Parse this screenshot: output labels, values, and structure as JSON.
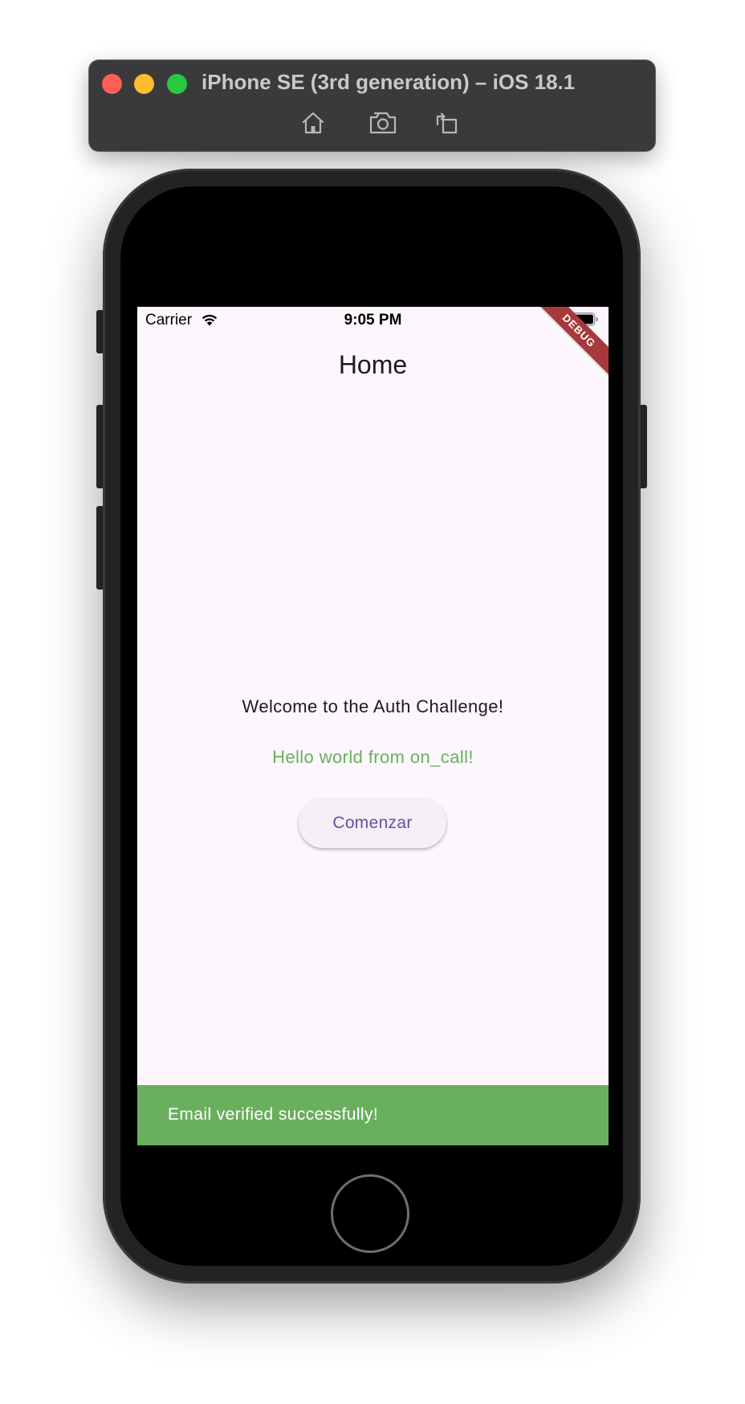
{
  "simulator": {
    "title": "iPhone SE (3rd generation) – iOS 18.1",
    "toolbar": {
      "home_icon": "home-icon",
      "screenshot_icon": "camera-icon",
      "rotate_icon": "rotate-icon"
    }
  },
  "status_bar": {
    "carrier": "Carrier",
    "time": "9:05 PM"
  },
  "debug_banner": "DEBUG",
  "app_bar": {
    "title": "Home"
  },
  "body": {
    "welcome": "Welcome to the Auth Challenge!",
    "hello": "Hello world from on_call!",
    "start_button": "Comenzar"
  },
  "snackbar": {
    "message": "Email verified successfully!"
  },
  "colors": {
    "screen_background": "#fdf7fd",
    "accent": "#6750a4",
    "success_green": "#69af5e",
    "debug_red": "#a63a3a"
  }
}
